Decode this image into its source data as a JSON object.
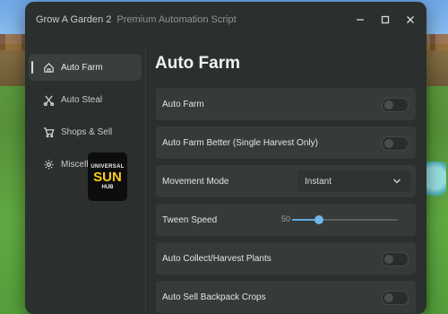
{
  "window": {
    "title": "Grow A Garden 2",
    "subtitle": "Premium Automation Script",
    "controls": [
      "minimize-icon",
      "maximize-icon",
      "close-icon"
    ]
  },
  "sidebar": {
    "items": [
      {
        "label": "Auto Farm",
        "icon": "home-icon",
        "active": true
      },
      {
        "label": "Auto Steal",
        "icon": "scissors-icon",
        "active": false
      },
      {
        "label": "Shops & Sell",
        "icon": "cart-icon",
        "active": false
      },
      {
        "label": "Miscellan",
        "icon": "gear-icon",
        "active": false
      }
    ]
  },
  "logo": {
    "line1": "UNIVERSAL",
    "line2": "SUN",
    "line3": "HUB",
    "accent_color": "#ffcc1a"
  },
  "main": {
    "title": "Auto Farm",
    "settings": [
      {
        "type": "toggle",
        "label": "Auto Farm",
        "enabled": false
      },
      {
        "type": "toggle",
        "label": "Auto Farm Better (Single Harvest Only)",
        "enabled": false
      },
      {
        "type": "dropdown",
        "label": "Movement Mode",
        "value": "Instant"
      },
      {
        "type": "slider",
        "label": "Tween Speed",
        "value": "50",
        "fraction": 0.25
      },
      {
        "type": "toggle",
        "label": "Auto Collect/Harvest Plants",
        "enabled": false
      },
      {
        "type": "toggle",
        "label": "Auto Sell Backpack Crops",
        "enabled": false
      }
    ]
  },
  "colors": {
    "panel_bg": "#2b2f2e",
    "row_bg": "#363a39",
    "slider_accent": "#5fa9e0"
  }
}
